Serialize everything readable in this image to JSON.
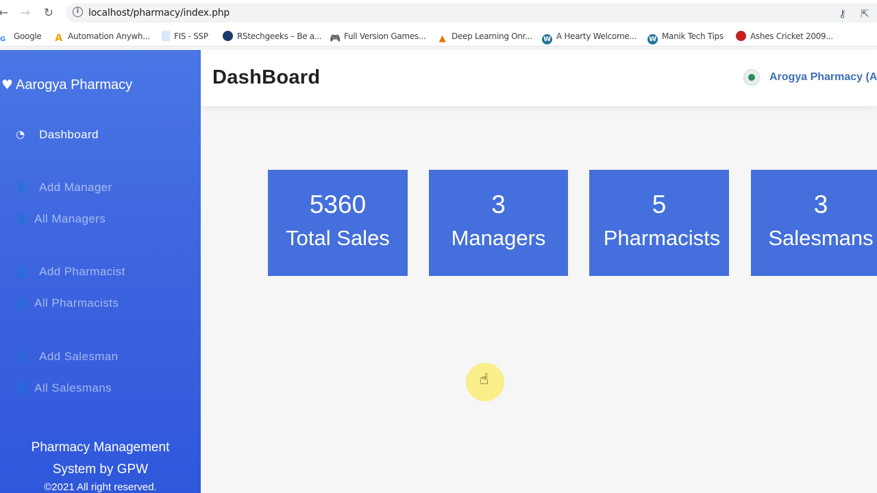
{
  "browser": {
    "url": "localhost/pharmacy/index.php",
    "bookmarks": [
      {
        "label": "Google",
        "icon": "google-icon",
        "color": "#4285f4"
      },
      {
        "label": "Automation Anywh...",
        "icon": "automation-anywhere-icon",
        "color": "#f29f05"
      },
      {
        "label": "FIS - SSP",
        "icon": "document-icon",
        "color": "#8ab4f8"
      },
      {
        "label": "RStechgeeks – Be a...",
        "icon": "rstechgeeks-icon",
        "color": "#1a73e8"
      },
      {
        "label": "Full Version Games...",
        "icon": "gamepad-icon",
        "color": "#202124"
      },
      {
        "label": "Deep Learning Onr...",
        "icon": "matlab-icon",
        "color": "#e8710a"
      },
      {
        "label": "A Hearty Welcome...",
        "icon": "wordpress-icon",
        "color": "#21759b"
      },
      {
        "label": "Manik Tech Tips",
        "icon": "wordpress-icon",
        "color": "#21759b"
      },
      {
        "label": "Ashes Cricket 2009...",
        "icon": "cricket-icon",
        "color": "#c5221f"
      }
    ]
  },
  "sidebar": {
    "brand": "Aarogya Pharmacy",
    "items": [
      {
        "label": "Dashboard",
        "icon": "dashboard-icon",
        "active": true
      },
      {
        "label": "Add Manager",
        "icon": "add-user-icon"
      },
      {
        "label": "All Managers",
        "icon": "user-icon"
      },
      {
        "label": "Add Pharmacist",
        "icon": "add-user-icon"
      },
      {
        "label": "All Pharmacists",
        "icon": "user-icon"
      },
      {
        "label": "Add Salesman",
        "icon": "add-user-icon"
      },
      {
        "label": "All Salesmans",
        "icon": "user-icon"
      }
    ],
    "footer_line1": "Pharmacy Management",
    "footer_line2": "System by GPW",
    "footer_copyright": "©2021 All right reserved."
  },
  "header": {
    "title": "DashBoard",
    "user_name": "Arogya Pharmacy (A"
  },
  "cards": [
    {
      "value": "5360",
      "label": "Total Sales"
    },
    {
      "value": "3",
      "label": "Managers"
    },
    {
      "value": "5",
      "label": "Pharmacists"
    },
    {
      "value": "3",
      "label": "Salesmans"
    }
  ],
  "colors": {
    "sidebar_top": "#4a77e6",
    "sidebar_bottom": "#2f57db",
    "card": "#446fdc",
    "user_name": "#3d6fb8"
  }
}
